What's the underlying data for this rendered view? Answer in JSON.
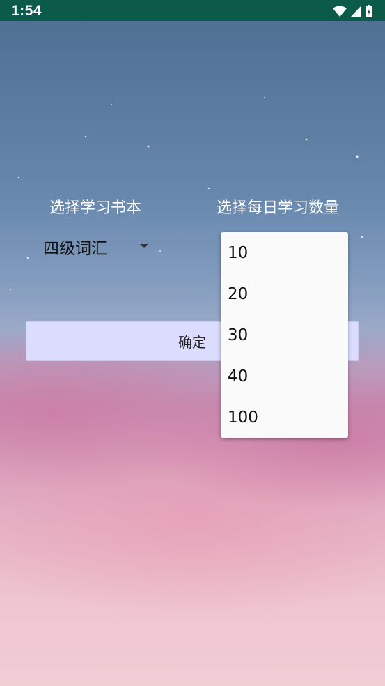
{
  "status_bar": {
    "time": "1:54"
  },
  "labels": {
    "book": "选择学习书本",
    "daily_count": "选择每日学习数量"
  },
  "book_select": {
    "value": "四级词汇"
  },
  "confirm_button": {
    "label": "确定"
  },
  "count_menu": {
    "options": [
      "10",
      "20",
      "30",
      "40",
      "100"
    ]
  },
  "colors": {
    "status_bar": "#0b5a4a",
    "confirm_bg": "#dcdcff",
    "menu_bg": "#fafafa"
  },
  "icons": [
    "wifi-icon",
    "signal-icon",
    "battery-icon",
    "dropdown-arrow-icon",
    "moon-icon"
  ]
}
